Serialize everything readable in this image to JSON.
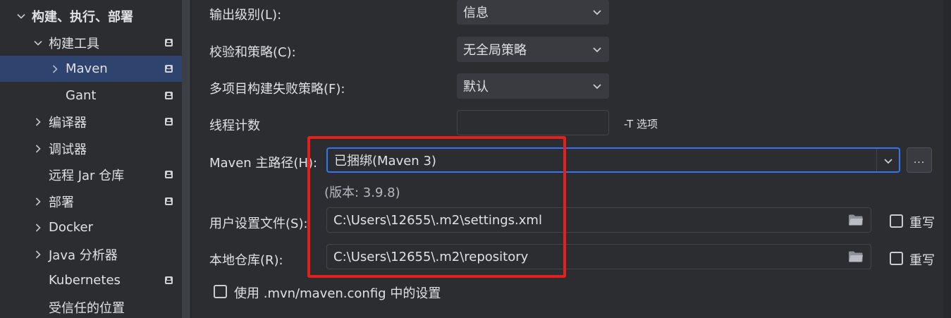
{
  "sidebar": {
    "items": [
      {
        "label": "构建、执行、部署",
        "chevron": "down"
      },
      {
        "label": "构建工具",
        "chevron": "down"
      },
      {
        "label": "Maven",
        "chevron": "right"
      },
      {
        "label": "Gant",
        "chevron": "none"
      },
      {
        "label": "编译器",
        "chevron": "right"
      },
      {
        "label": "调试器",
        "chevron": "right"
      },
      {
        "label": "远程 Jar 仓库",
        "chevron": "none"
      },
      {
        "label": "部署",
        "chevron": "right"
      },
      {
        "label": "Docker",
        "chevron": "right"
      },
      {
        "label": "Java 分析器",
        "chevron": "right"
      },
      {
        "label": "Kubernetes",
        "chevron": "none"
      },
      {
        "label": "受信任的位置",
        "chevron": "none"
      }
    ],
    "selected": "Maven"
  },
  "form": {
    "output_level_label": "输出级别(L):",
    "output_level_value": "信息",
    "checksum_label": "校验和策略(C):",
    "checksum_value": "无全局策略",
    "multiproject_label": "多项目构建失败策略(F):",
    "multiproject_value": "默认",
    "threads_label": "线程计数",
    "threads_value": "",
    "threads_hint": "-T 选项",
    "maven_home_label": "Maven 主路径(H):",
    "maven_home_value": "已捆绑(Maven 3)",
    "browse_label": "...",
    "version_text": "(版本: 3.9.8)",
    "user_settings_label": "用户设置文件(S):",
    "user_settings_value": "C:\\Users\\12655\\.m2\\settings.xml",
    "override_label": "重写",
    "local_repo_label": "本地仓库(R):",
    "local_repo_value": "C:\\Users\\12655\\.m2\\repository",
    "use_mvn_config_label": "使用 .mvn/maven.config 中的设置"
  },
  "colors": {
    "selection": "#2e436e",
    "focus_border": "#3574f0",
    "annotation": "#e5201c"
  }
}
